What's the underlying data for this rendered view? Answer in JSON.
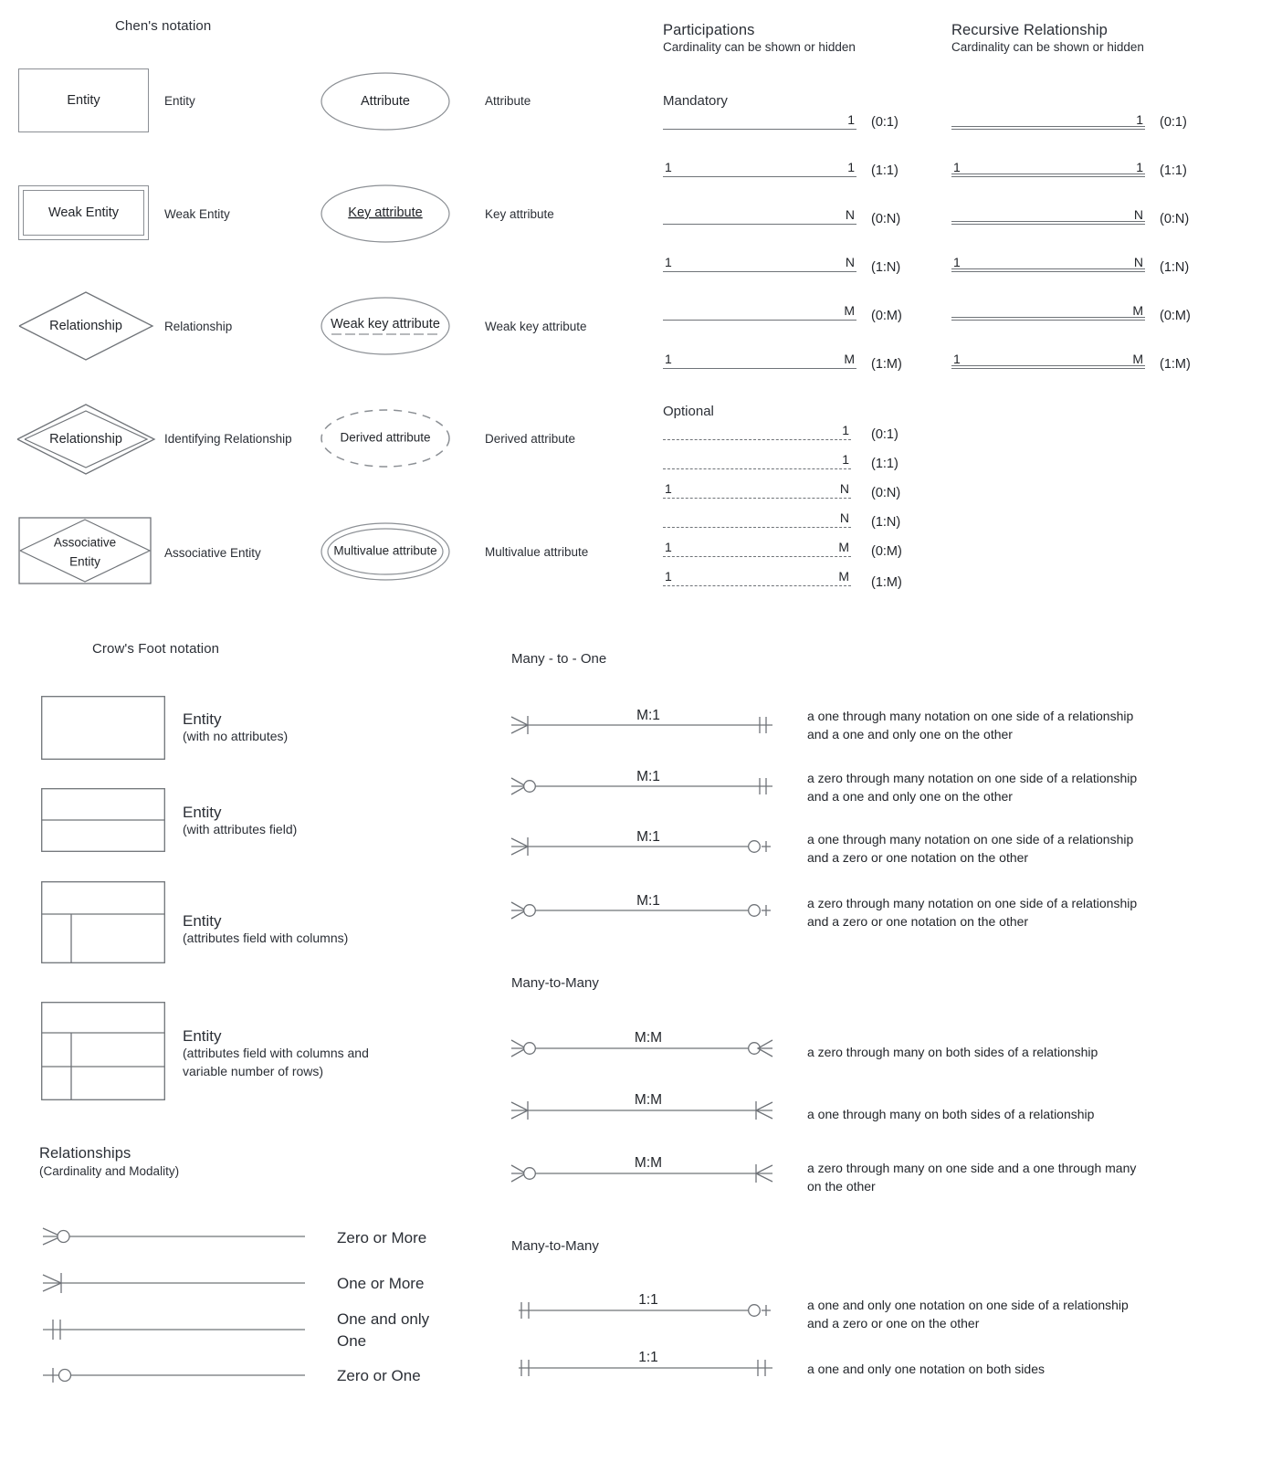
{
  "chen": {
    "title": "Chen's notation",
    "shapes": [
      {
        "shape_text": "Entity",
        "label": "Entity"
      },
      {
        "shape_text": "Weak Entity",
        "label": "Weak Entity"
      },
      {
        "shape_text": "Relationship",
        "label": "Relationship"
      },
      {
        "shape_text": "Relationship",
        "label": "Identifying Relationship"
      },
      {
        "shape_text": "Associative Entity",
        "label": "Associative Entity"
      }
    ],
    "attributes": [
      {
        "shape_text": "Attribute",
        "label": "Attribute"
      },
      {
        "shape_text": "Key attribute",
        "label": "Key attribute"
      },
      {
        "shape_text": "Weak key attribute",
        "label": "Weak key attribute"
      },
      {
        "shape_text": "Derived attribute",
        "label": "Derived attribute"
      },
      {
        "shape_text": "Multivalue attribute",
        "label": "Multivalue attribute"
      }
    ]
  },
  "participations": {
    "title": "Participations",
    "subtitle": "Cardinality can be shown or hidden",
    "mandatory_label": "Mandatory",
    "optional_label": "Optional",
    "mandatory": [
      {
        "left": "",
        "right": "1",
        "pair": "(0:1)"
      },
      {
        "left": "1",
        "right": "1",
        "pair": "(1:1)"
      },
      {
        "left": "",
        "right": "N",
        "pair": "(0:N)"
      },
      {
        "left": "1",
        "right": "N",
        "pair": "(1:N)"
      },
      {
        "left": "",
        "right": "M",
        "pair": "(0:M)"
      },
      {
        "left": "1",
        "right": "M",
        "pair": "(1:M)"
      }
    ],
    "optional": [
      {
        "left": "",
        "right": "1",
        "pair": "(0:1)"
      },
      {
        "left": "",
        "right": "1",
        "pair": "(1:1)"
      },
      {
        "left": "1",
        "right": "N",
        "pair": "(0:N)"
      },
      {
        "left": "",
        "right": "N",
        "pair": "(1:N)"
      },
      {
        "left": "1",
        "right": "M",
        "pair": "(0:M)"
      },
      {
        "left": "1",
        "right": "M",
        "pair": "(1:M)"
      }
    ]
  },
  "recursive": {
    "title": "Recursive Relationship",
    "subtitle": "Cardinality can be shown or hidden",
    "rows": [
      {
        "left": "",
        "right": "1",
        "pair": "(0:1)"
      },
      {
        "left": "1",
        "right": "1",
        "pair": "(1:1)"
      },
      {
        "left": "",
        "right": "N",
        "pair": "(0:N)"
      },
      {
        "left": "1",
        "right": "N",
        "pair": "(1:N)"
      },
      {
        "left": "",
        "right": "M",
        "pair": "(0:M)"
      },
      {
        "left": "1",
        "right": "M",
        "pair": "(1:M)"
      }
    ]
  },
  "crowsfoot": {
    "title": "Crow's Foot notation",
    "entities": [
      {
        "name": "Entity",
        "sub": "(with no attributes)"
      },
      {
        "name": "Entity",
        "sub": "(with attributes field)"
      },
      {
        "name": "Entity",
        "sub": "(attributes field with columns)"
      },
      {
        "name": "Entity",
        "sub": "(attributes field with columns and\nvariable number of rows)"
      }
    ],
    "relationships_title": "Relationships",
    "relationships_sub": "(Cardinality and Modality)",
    "modality": [
      {
        "label": "Zero or More",
        "symbol": "crowsfoot-circle"
      },
      {
        "label": "One or More",
        "symbol": "crowsfoot-bar"
      },
      {
        "label": "One and only\nOne",
        "symbol": "double-bar"
      },
      {
        "label": "Zero or One",
        "symbol": "bar-circle"
      }
    ]
  },
  "many_to_one": {
    "title": "Many - to - One",
    "rows": [
      {
        "ratio": "M:1",
        "left": "crowsfoot-bar",
        "right": "double-bar",
        "desc": "a one through many notation on one side of a relationship\nand a one and only one on the other"
      },
      {
        "ratio": "M:1",
        "left": "crowsfoot-circle",
        "right": "double-bar",
        "desc": "a zero through many notation on one side of a relationship\nand a one and only one on the other"
      },
      {
        "ratio": "M:1",
        "left": "crowsfoot-bar",
        "right": "circle-bar",
        "desc": "a one through many notation on one side of a relationship\nand a zero or one notation on the other"
      },
      {
        "ratio": "M:1",
        "left": "crowsfoot-circle",
        "right": "circle-bar",
        "desc": "a zero through many notation on one side of a relationship\nand a zero or one notation on the other"
      }
    ]
  },
  "many_to_many": {
    "title": "Many-to-Many",
    "rows": [
      {
        "ratio": "M:M",
        "left": "crowsfoot-circle",
        "right": "circle-crowsfoot",
        "desc": "a zero through many on both sides of a relationship"
      },
      {
        "ratio": "M:M",
        "left": "crowsfoot-bar",
        "right": "crowsfoot-bar-r",
        "desc": "a one through many on both sides of a relationship"
      },
      {
        "ratio": "M:M",
        "left": "crowsfoot-circle",
        "right": "crowsfoot-bar-r",
        "desc": "a zero through many on one side and a one through many\non the other"
      }
    ]
  },
  "one_to_one": {
    "title": "Many-to-Many",
    "rows": [
      {
        "ratio": "1:1",
        "left": "double-bar",
        "right": "circle-bar",
        "desc": "a one and only one notation on one side of a relationship\nand a zero or one on the other"
      },
      {
        "ratio": "1:1",
        "left": "double-bar",
        "right": "double-bar-r",
        "desc": "a one and only one notation on both sides"
      }
    ]
  },
  "colors": {
    "stroke": "#6f7378",
    "text": "#22252a",
    "background": "#ffffff"
  }
}
